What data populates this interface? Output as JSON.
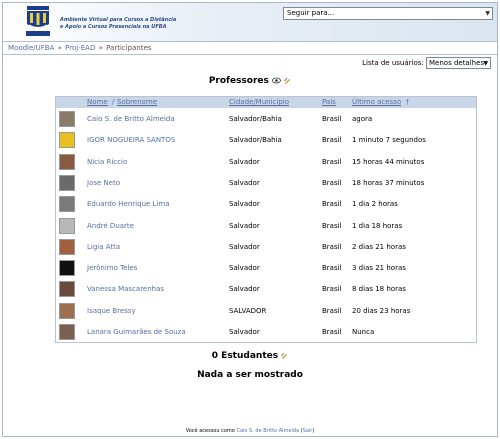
{
  "header": {
    "logo_label": "UFBA",
    "tagline_line1": "Ambiente Virtual para Cursos a Distância",
    "tagline_line2": "e Apoio a Cursos Presenciais na UFBA",
    "jump_menu": "Seguir para..."
  },
  "breadcrumb": {
    "home": "Moodle/UFBA",
    "course": "Proj-EAD",
    "current": "Participantes",
    "separator": "»"
  },
  "user_list": {
    "label": "Lista de usuários:",
    "selected": "Menos detalhes"
  },
  "teachers": {
    "title": "Professores",
    "columns": {
      "name": "Nome",
      "surname": "Sobrenome",
      "city": "Cidade/Município",
      "country": "País",
      "last_access": "Último acesso"
    },
    "rows": [
      {
        "name": "Caio S. de Britto Almeida",
        "city": "Salvador/Bahia",
        "country": "Brasil",
        "access": "agora",
        "avatar_color": "#8a7a6a"
      },
      {
        "name": "IGOR NOGUEIRA SANTOS",
        "city": "Salvador/Bahia",
        "country": "Brasil",
        "access": "1 minuto 7 segundos",
        "avatar_color": "#e8c020"
      },
      {
        "name": "Nicia Riccio",
        "city": "Salvador",
        "country": "Brasil",
        "access": "15 horas 44 minutos",
        "avatar_color": "#8a5a40"
      },
      {
        "name": "Jose Neto",
        "city": "Salvador",
        "country": "Brasil",
        "access": "18 horas 37 minutos",
        "avatar_color": "#6a6a6a"
      },
      {
        "name": "Eduardo Henrique Lima",
        "city": "Salvador",
        "country": "Brasil",
        "access": "1 dia 2 horas",
        "avatar_color": "#7a7a7a"
      },
      {
        "name": "André Duarte",
        "city": "Salvador",
        "country": "Brasil",
        "access": "1 dia 18 horas",
        "avatar_color": "#b8b8b8"
      },
      {
        "name": "Ligia Atta",
        "city": "Salvador",
        "country": "Brasil",
        "access": "2 dias 21 horas",
        "avatar_color": "#a06040"
      },
      {
        "name": "Jerônimo Teles",
        "city": "Salvador",
        "country": "Brasil",
        "access": "3 dias 21 horas",
        "avatar_color": "#101010"
      },
      {
        "name": "Vanessa Mascarenhas",
        "city": "Salvador",
        "country": "Brasil",
        "access": "8 dias 18 horas",
        "avatar_color": "#6a4a3a"
      },
      {
        "name": "Isaque Bressy",
        "city": "SALVADOR",
        "country": "Brasil",
        "access": "20 dias 23 horas",
        "avatar_color": "#9a7050"
      },
      {
        "name": "Lanara Guimarães de Souza",
        "city": "Salvador",
        "country": "Brasil",
        "access": "Nunca",
        "avatar_color": "#7a6050"
      }
    ]
  },
  "students": {
    "title": "0 Estudantes",
    "empty_message": "Nada a ser mostrado"
  },
  "footer": {
    "prefix": "Você acessou como",
    "user": "Caio S. de Britto Almeida",
    "logout": "Sair"
  }
}
